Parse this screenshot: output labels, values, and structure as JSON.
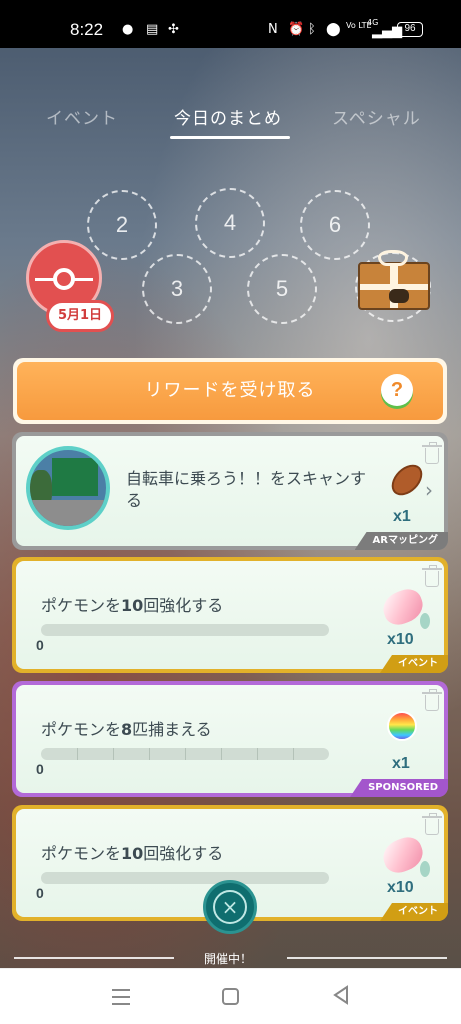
{
  "status_bar": {
    "time": "8:22",
    "battery": "96",
    "icons": [
      "line-app-icon",
      "news-icon",
      "app-icon",
      "nfc-icon",
      "alarm-icon",
      "bluetooth-icon",
      "location-icon",
      "volte-icon",
      "signal-icon"
    ],
    "volte_label": "Vo LTE",
    "network_label": "4G"
  },
  "tabs": [
    {
      "label": "イベント",
      "active": false
    },
    {
      "label": "今日のまとめ",
      "active": true
    },
    {
      "label": "スペシャル",
      "active": false
    }
  ],
  "streak": {
    "days": [
      "2",
      "3",
      "4",
      "5",
      "6"
    ],
    "date_badge": "5月1日"
  },
  "reward_button": {
    "label": "リワードを受け取る",
    "help_icon": "?"
  },
  "tasks": [
    {
      "title": "自転車に乗ろう！！をスキャンする",
      "quantity": "x1",
      "tag": "ARマッピング",
      "reward_icon": "berry-icon"
    },
    {
      "title_prefix": "ポケモンを",
      "title_number": "10",
      "title_suffix": "回強化する",
      "progress_count": "0",
      "progress": 0,
      "quantity": "x10",
      "tag": "イベント",
      "reward_icon": "candy-icon"
    },
    {
      "title_prefix": "ポケモンを",
      "title_number": "8",
      "title_suffix": "匹捕まえる",
      "progress_count": "0",
      "progress": 0,
      "quantity": "x1",
      "tag": "SPONSORED",
      "reward_icon": "rainbow-ball-icon"
    },
    {
      "title_prefix": "ポケモンを",
      "title_number": "10",
      "title_suffix": "回強化する",
      "progress_count": "0",
      "progress": 0,
      "quantity": "x10",
      "tag": "イベント",
      "reward_icon": "candy-icon"
    }
  ],
  "footer": {
    "open_label": "開催中！",
    "close_symbol": "×"
  },
  "colors": {
    "reward_orange": "#f79a3e",
    "card_grey": "#9a9a9a",
    "card_gold": "#e2b12a",
    "card_purple": "#b36ad8",
    "fab_teal": "#0f6e6f"
  }
}
